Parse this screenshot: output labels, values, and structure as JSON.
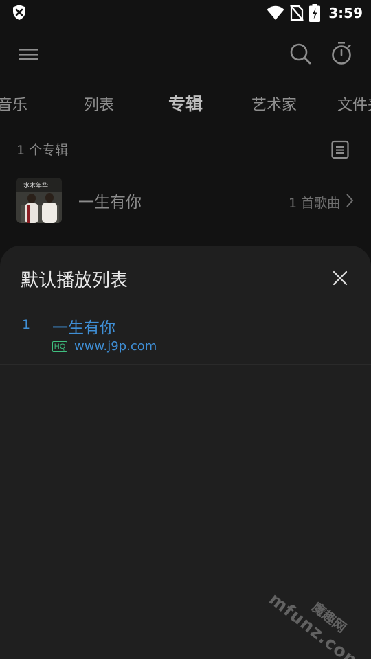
{
  "status_bar": {
    "time": "3:59",
    "icons": [
      "shield-icon",
      "wifi-icon",
      "no-sim-icon",
      "battery-charging-icon"
    ]
  },
  "app_bar": {
    "icons": [
      "menu-icon",
      "search-icon",
      "timer-icon"
    ]
  },
  "tabs": [
    {
      "label": "音乐",
      "active": false
    },
    {
      "label": "列表",
      "active": false
    },
    {
      "label": "专辑",
      "active": true
    },
    {
      "label": "艺术家",
      "active": false
    },
    {
      "label": "文件夹",
      "active": false
    }
  ],
  "album_list": {
    "count_label": "1 个专辑",
    "albums": [
      {
        "title": "一生有你",
        "song_count": "1 首歌曲",
        "cover_text": "水木年华"
      }
    ]
  },
  "sheet": {
    "title": "默认播放列表",
    "items": [
      {
        "index": "1",
        "title": "一生有你",
        "quality_badge": "HQ",
        "artist": "www.j9p.com"
      }
    ]
  },
  "watermark": {
    "text": "mfunz.com",
    "cn_text": "魔趣网"
  },
  "colors": {
    "background": "#121212",
    "sheet_background": "#1f1f1f",
    "accent_blue": "#3f8fd6",
    "hq_green": "#3fbf7f"
  }
}
